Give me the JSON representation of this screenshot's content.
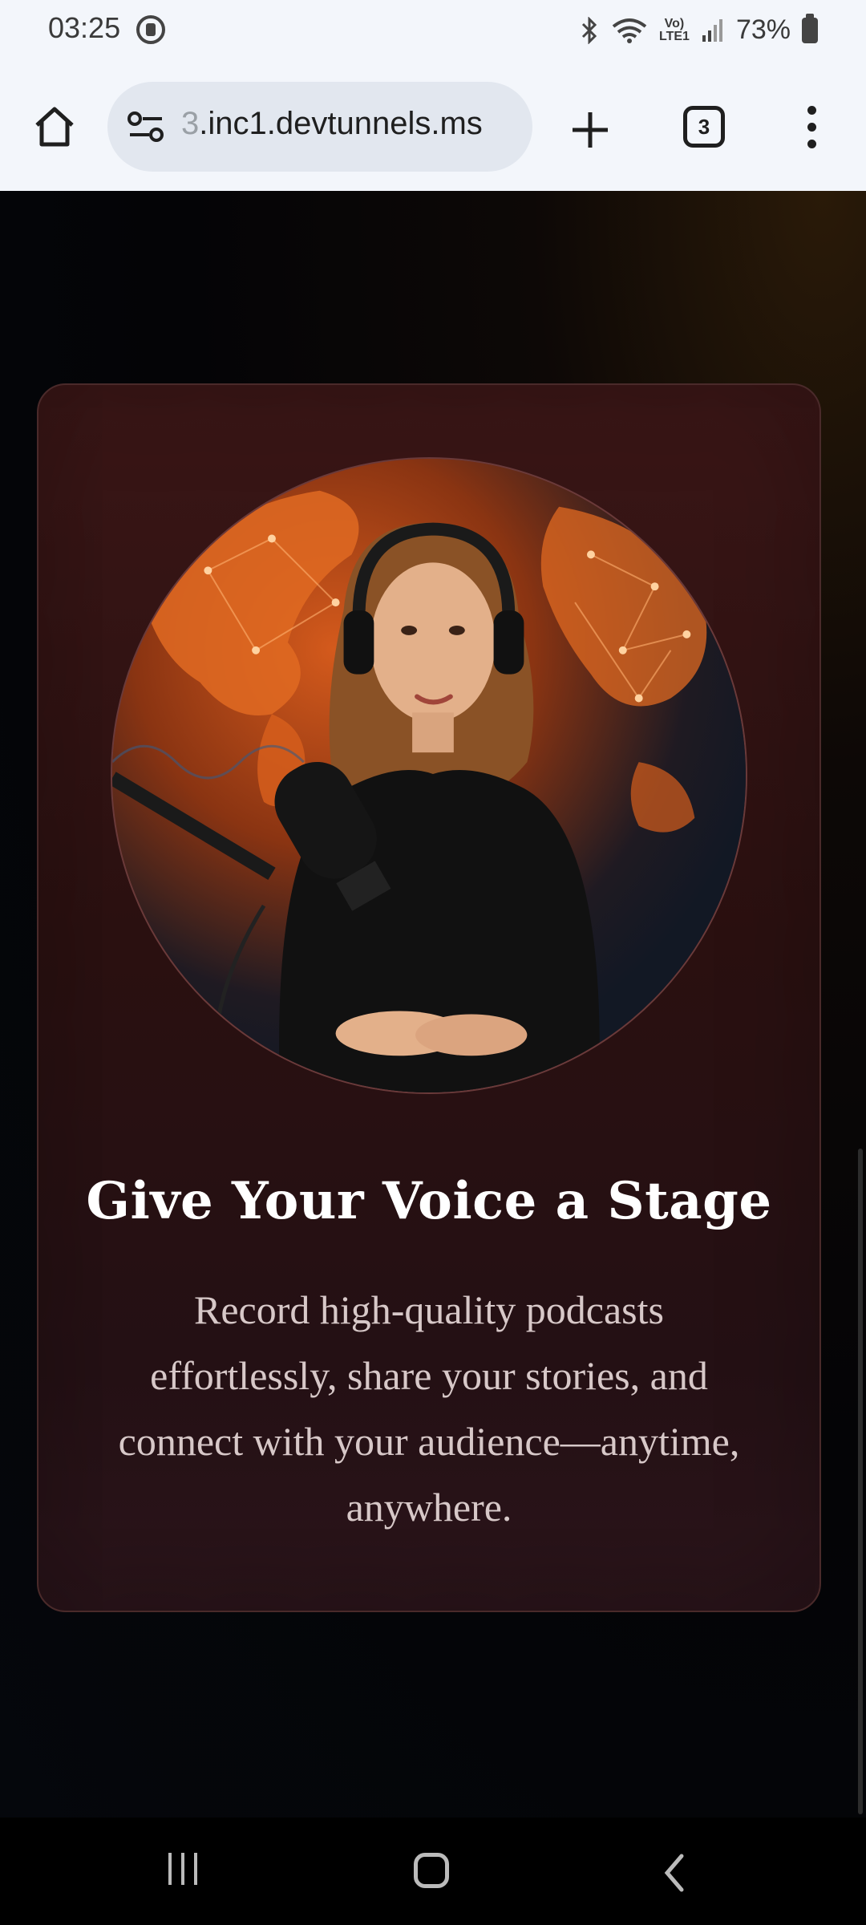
{
  "status_bar": {
    "time": "03:25",
    "signal_label": "Vo)\nLTE1",
    "battery_percent": "73%",
    "icons": [
      "recording-icon",
      "bluetooth-icon",
      "wifi-icon",
      "volte-icon",
      "signal-icon",
      "battery-icon"
    ]
  },
  "browser": {
    "url_faded_prefix": "3",
    "url_text": ".inc1.devtunnels.ms",
    "tab_count": "3",
    "icons": [
      "home-icon",
      "site-settings-icon",
      "new-tab-icon",
      "tabs-icon",
      "more-menu-icon"
    ]
  },
  "hero": {
    "title": "Give Your Voice a Stage",
    "description": "Record high-quality podcasts effortlessly, share your stories, and connect with your audience—anytime, anywhere."
  },
  "nav_bar": {
    "icons": [
      "recents-icon",
      "home-nav-icon",
      "back-icon"
    ]
  },
  "colors": {
    "card_background": "#2a1010",
    "title": "#ffffff",
    "text": "#d7c8c8",
    "accent": "#e0621e"
  }
}
